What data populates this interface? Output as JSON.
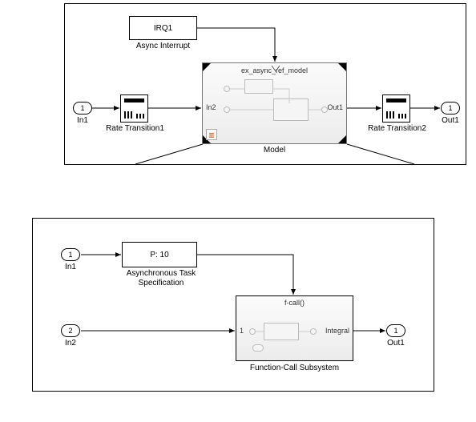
{
  "top": {
    "irq": {
      "text": "IRQ1",
      "label": "Async Interrupt"
    },
    "in1": {
      "num": "1",
      "label": "In1"
    },
    "out1": {
      "num": "1",
      "label": "Out1"
    },
    "rt1_label": "Rate Transition1",
    "rt2_label": "Rate Transition2",
    "model": {
      "title": "ex_async_ref_model",
      "in_port": "In2",
      "out_port": "Out1",
      "label": "Model"
    }
  },
  "bottom": {
    "in1": {
      "num": "1",
      "label": "In1"
    },
    "in2": {
      "num": "2",
      "label": "In2"
    },
    "out1": {
      "num": "1",
      "label": "Out1"
    },
    "ats": {
      "text": "P: 10",
      "label1": "Asynchronous Task",
      "label2": "Specification"
    },
    "fcs": {
      "trigger": "f-call()",
      "port_in": "1",
      "port_out": "Integral",
      "label": "Function-Call Subsystem"
    }
  }
}
